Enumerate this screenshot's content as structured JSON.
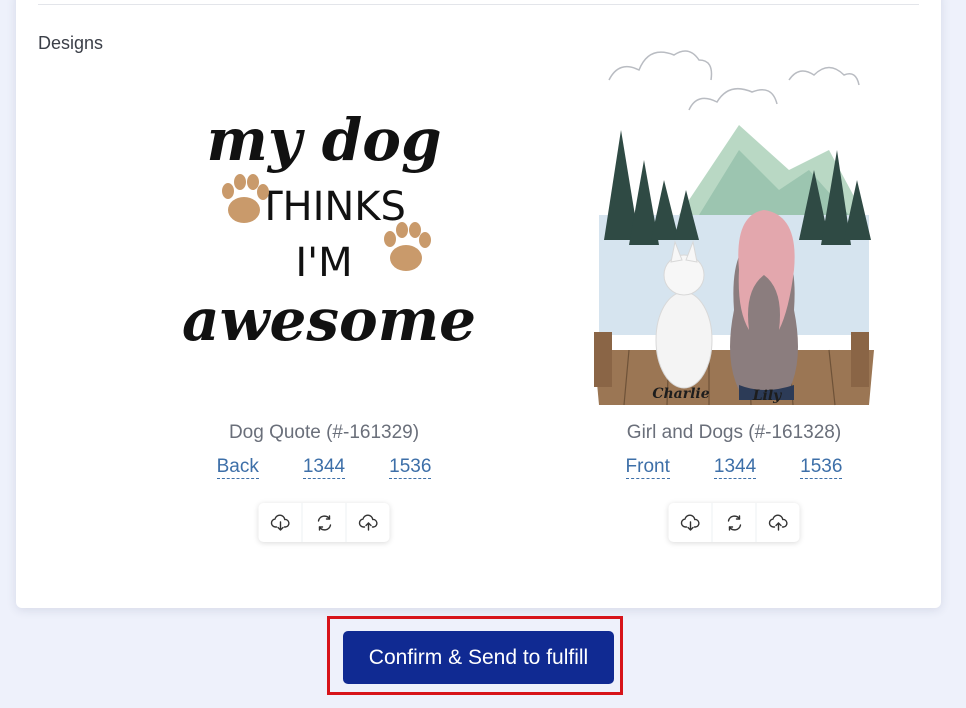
{
  "section": {
    "title": "Designs"
  },
  "designs": [
    {
      "name": "Dog Quote (#-161329)",
      "side": "Back",
      "width": "1344",
      "height": "1536",
      "artwork_text": {
        "line1": "my dog",
        "line2": "THINKS",
        "line3": "I'M",
        "line4": "awesome"
      }
    },
    {
      "name": "Girl and Dogs (#-161328)",
      "side": "Front",
      "width": "1344",
      "height": "1536",
      "artwork_text": {
        "dog_name": "Charlie",
        "girl_name": "Lily"
      }
    }
  ],
  "icons": [
    "cloud-download-icon",
    "refresh-icon",
    "cloud-upload-icon"
  ],
  "confirm_button": {
    "label": "Confirm & Send to fulfill"
  },
  "colors": {
    "primary": "#102a92",
    "highlight": "#d7141a",
    "link": "#3d6fa8",
    "background": "#eef1fb"
  }
}
